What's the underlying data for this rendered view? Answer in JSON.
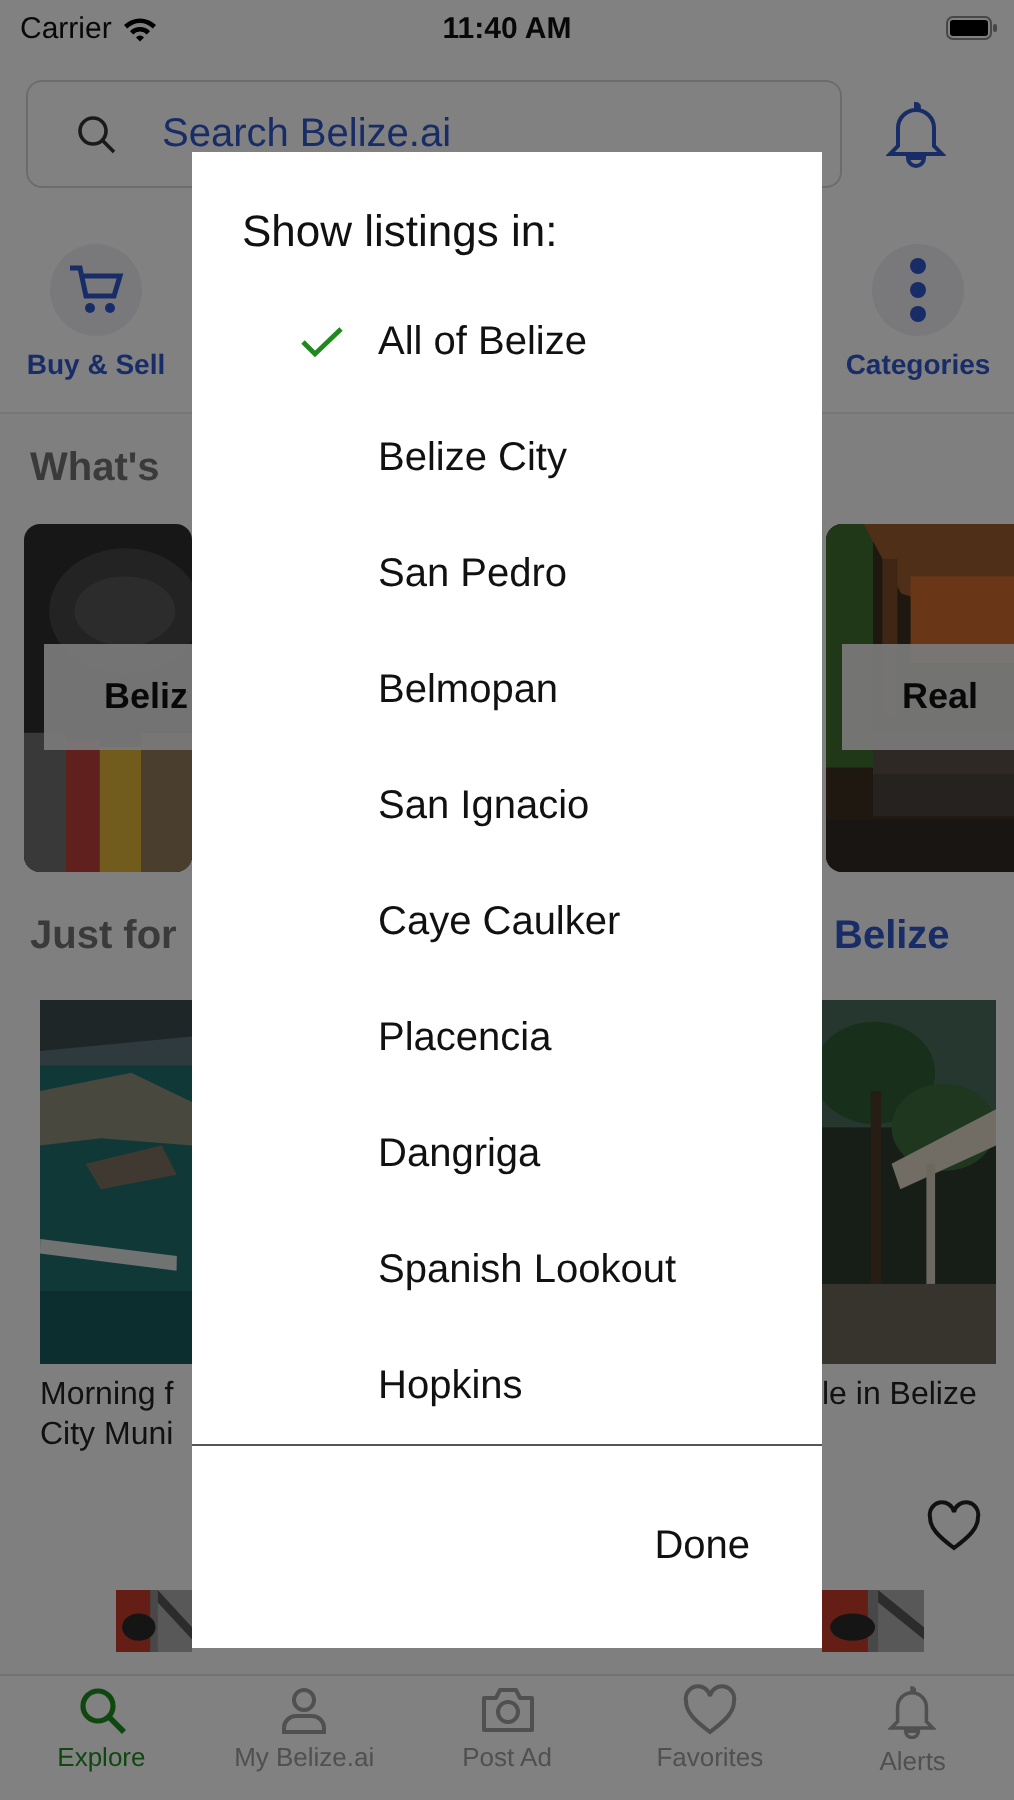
{
  "status_bar": {
    "carrier": "Carrier",
    "time": "11:40 AM"
  },
  "search": {
    "placeholder": "Search Belize.ai"
  },
  "quick_links": [
    {
      "label": "Buy & Sell"
    },
    {
      "label": "Categories"
    }
  ],
  "section_1": {
    "title": "What's"
  },
  "featured": [
    {
      "label": "Beliz"
    },
    {
      "label": "Real"
    }
  ],
  "section_2": {
    "title": "Just for",
    "link": "Belize"
  },
  "listings": [
    {
      "title_lines": [
        "Morning f",
        "City Muni"
      ]
    },
    {
      "title_lines": [
        "le in Belize"
      ],
      "favorite": false
    }
  ],
  "tab_bar": [
    {
      "label": "Explore",
      "selected": true
    },
    {
      "label": "My Belize.ai",
      "selected": false
    },
    {
      "label": "Post Ad",
      "selected": false
    },
    {
      "label": "Favorites",
      "selected": false
    },
    {
      "label": "Alerts",
      "selected": false
    }
  ],
  "dialog": {
    "title": "Show listings in:",
    "options": [
      {
        "label": "All of Belize",
        "selected": true
      },
      {
        "label": "Belize City",
        "selected": false
      },
      {
        "label": "San Pedro",
        "selected": false
      },
      {
        "label": "Belmopan",
        "selected": false
      },
      {
        "label": "San Ignacio",
        "selected": false
      },
      {
        "label": "Caye Caulker",
        "selected": false
      },
      {
        "label": "Placencia",
        "selected": false
      },
      {
        "label": "Dangriga",
        "selected": false
      },
      {
        "label": "Spanish Lookout",
        "selected": false
      },
      {
        "label": "Hopkins",
        "selected": false
      }
    ],
    "done": "Done"
  }
}
